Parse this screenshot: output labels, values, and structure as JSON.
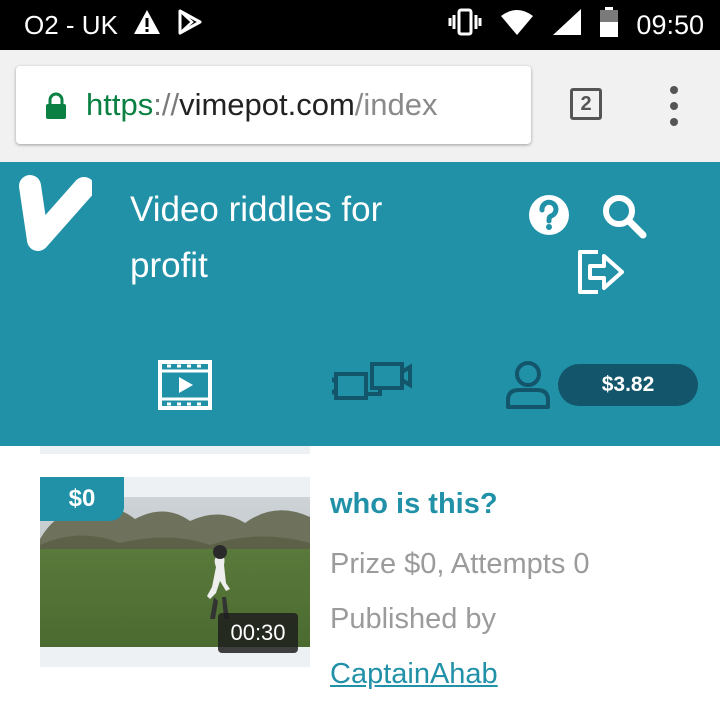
{
  "status_bar": {
    "carrier": "O2 - UK",
    "time": "09:50",
    "icons": [
      "warning-icon",
      "play-store-icon",
      "vibrate-icon",
      "wifi-icon",
      "signal-icon",
      "battery-icon"
    ]
  },
  "browser": {
    "url": {
      "scheme": "https",
      "separator": "://",
      "host": "vimepot.com",
      "path": "/index"
    },
    "tab_count": "2",
    "icons": [
      "lock-icon",
      "tabs-icon",
      "overflow-menu-icon"
    ]
  },
  "header": {
    "tagline_line1": "Video riddles for",
    "tagline_line2": "profit",
    "icons": [
      "logo-icon",
      "help-icon",
      "search-icon",
      "logout-icon"
    ]
  },
  "nav": {
    "icons": [
      "videos-icon",
      "video-call-icon",
      "user-icon"
    ],
    "balance": "$3.82"
  },
  "colors": {
    "brand": "#2191a8",
    "balance_pill": "#13556a",
    "url_scheme": "#0b8043",
    "muted_text": "#9b9b9b"
  },
  "video": {
    "prize_badge": "$0",
    "duration": "00:30",
    "title": "who is this?",
    "stats": "Prize $0, Attempts 0",
    "published_by": "Published by",
    "author": "CaptainAhab"
  }
}
